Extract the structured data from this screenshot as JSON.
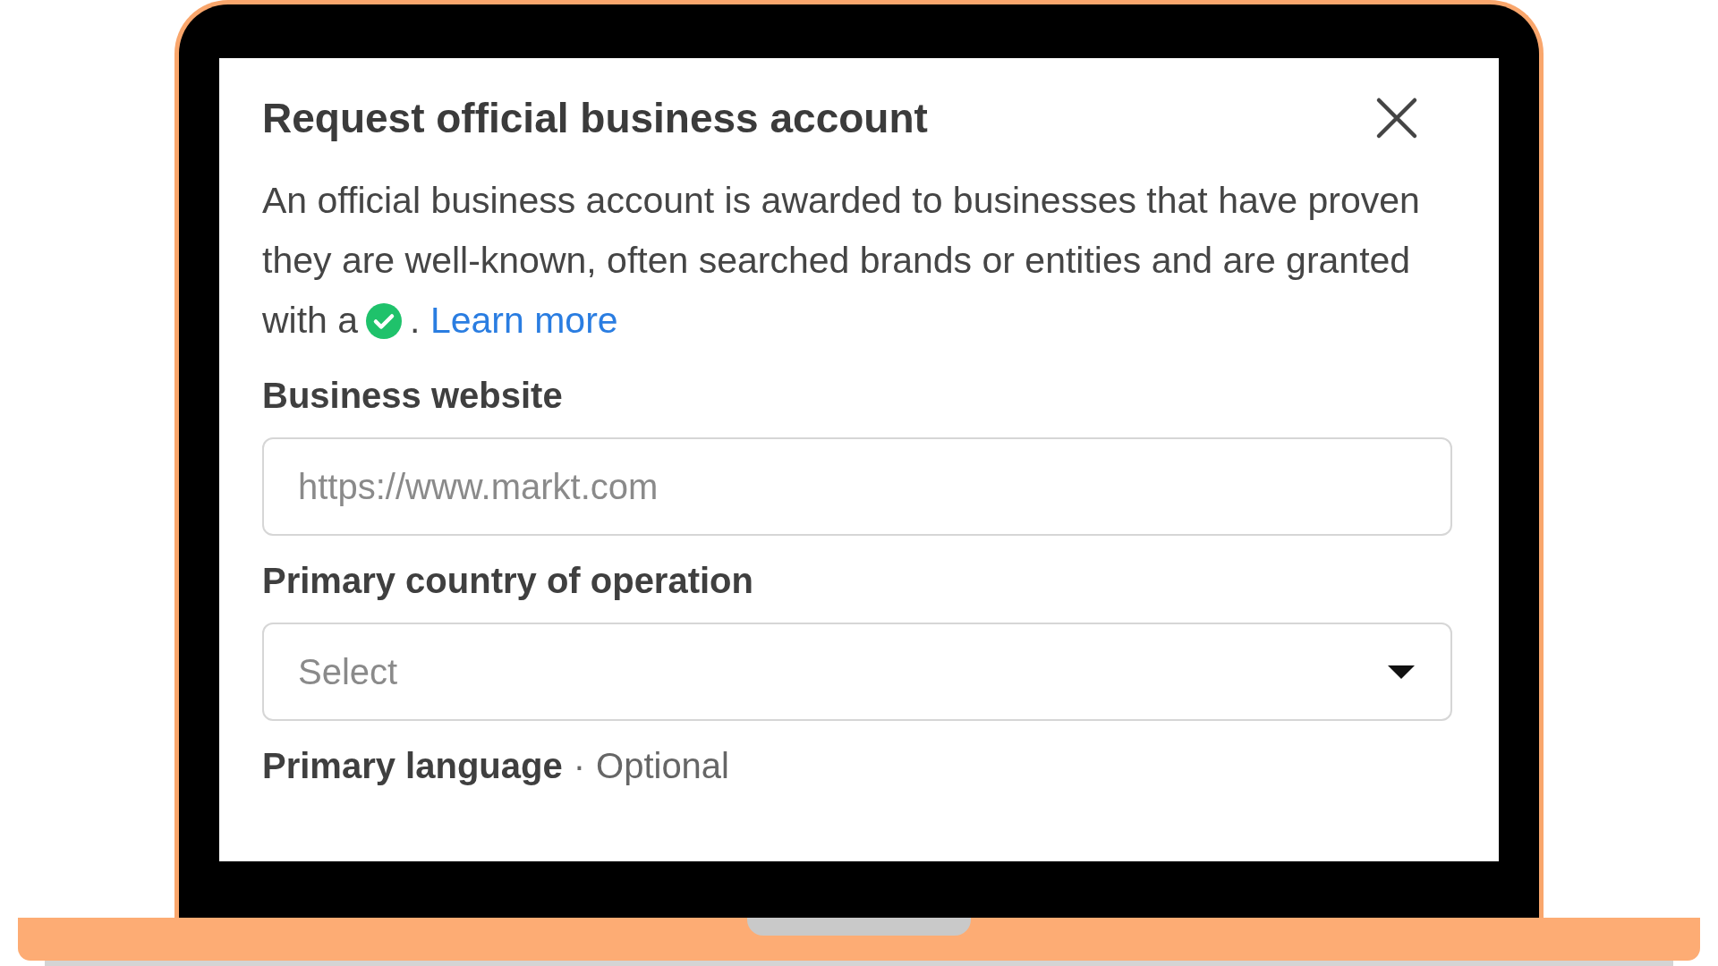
{
  "dialog": {
    "title": "Request official business account",
    "description": {
      "text_before": "An official business account is awarded to businesses that have proven they are well-known, often searched brands or entities and are granted with a",
      "text_after": ".",
      "link": "Learn more"
    },
    "fields": [
      {
        "kind": "input",
        "label": "Business website",
        "placeholder": "https://www.markt.com"
      },
      {
        "kind": "select",
        "label": "Primary country of operation",
        "placeholder": "Select"
      },
      {
        "kind": "heading",
        "label": "Primary language",
        "separator": "·",
        "note": "Optional"
      }
    ]
  }
}
